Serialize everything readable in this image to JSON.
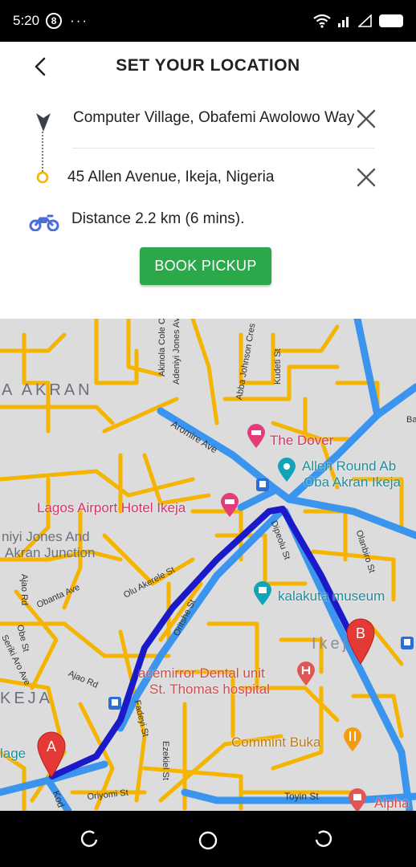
{
  "status": {
    "time": "5:20",
    "circle_badge": "8",
    "dots": "···"
  },
  "header": {
    "title": "SET YOUR LOCATION"
  },
  "route": {
    "origin": "Computer Village, Obafemi Awolowo Way",
    "destination": "45 Allen Avenue, Ikeja, Nigeria",
    "distance": "Distance 2.2 km (6 mins).",
    "book_label": "BOOK PICKUP"
  },
  "map": {
    "route_color": "#1a1ac8",
    "road_color": "#f5b400",
    "labels": {
      "akran": "A AKRAN",
      "akinola": "Akinola Cole C",
      "adeniyi": "Adeniyi Jones Av",
      "abba": "Abba Johnson Cres",
      "kudeti": "Kudeti St",
      "ba": "Ba",
      "aromire": "Aromire Ave",
      "the_dover": "The Dover",
      "allen_round": "Allen Round Ab",
      "oba_akran": "Oba Akran Ikeja",
      "lagos_airport": "Lagos Airport Hotel Ikeja",
      "jones_and": "niyi Jones And",
      "akran_junction": "Akran Junction",
      "dipeolu": "Dipeolu St",
      "olanbiro": "Olanbiro St",
      "ajao_rd_v": "Ajao Rd",
      "obanta": "Obanta Ave",
      "olu_akerele": "Olu Akerele St",
      "kalakuta": "kalakuta museum",
      "oritshe": "Oritshe St",
      "obe": "Obe St",
      "seriki": "Seriki Aro Ave",
      "ikeja_small": "Ikeja",
      "ajao_rd": "Ajao Rd",
      "dental": "acemirror Dental unit",
      "st_thomas": "St. Thomas hospital",
      "keja": "KEJA",
      "fadeyi": "Fadeyi St",
      "ezekiel": "Ezekiel St",
      "commint": "Commint Buka",
      "village": "lage",
      "kod": "Kod",
      "oriyomi": "Oriyomi St",
      "toyin": "Toyin St",
      "alpha": "Alpha"
    },
    "markers": {
      "a": "A",
      "b": "B"
    }
  }
}
